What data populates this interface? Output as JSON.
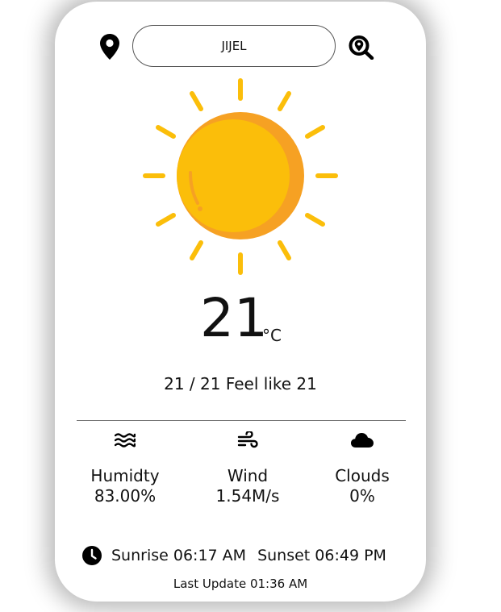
{
  "search": {
    "city_value": "JIJEL",
    "location_icon": "map-pin-icon",
    "search_icon": "search-location-icon"
  },
  "weather": {
    "condition_icon": "sun-icon",
    "temperature": "21",
    "unit": "°C",
    "feel_line": "21 / 21 Feel like 21"
  },
  "stats": [
    {
      "icon": "humidity-waves-icon",
      "label": "Humidty",
      "value": "83.00%"
    },
    {
      "icon": "wind-icon",
      "label": "Wind",
      "value": "1.54M/s"
    },
    {
      "icon": "cloud-icon",
      "label": "Clouds",
      "value": "0%"
    }
  ],
  "sun": {
    "clock_icon": "clock-icon",
    "sunrise": "Sunrise 06:17 AM",
    "sunset": "Sunset 06:49 PM"
  },
  "last_update": "Last Update 01:36 AM",
  "colors": {
    "sun_main": "#FBBE0A",
    "sun_shade": "#F6A123",
    "text": "#111111"
  }
}
